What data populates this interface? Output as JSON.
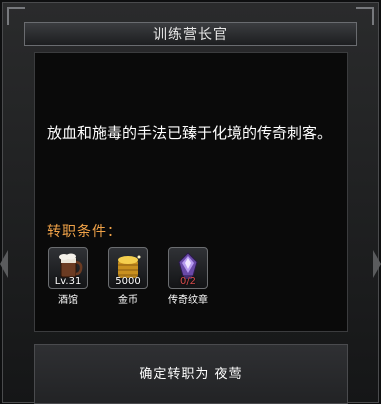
{
  "dialog": {
    "title": "训练营长官",
    "description": "放血和施毒的手法已臻于化境的传奇刺客。",
    "requirements_label": "转职条件：",
    "requirements": [
      {
        "icon": "tavern-icon",
        "badge": "Lv.31",
        "name": "酒馆"
      },
      {
        "icon": "gold-coins-icon",
        "badge": "5000",
        "name": "金币"
      },
      {
        "icon": "legendary-emblem-icon",
        "badge": "0/2",
        "name": "传奇纹章"
      }
    ],
    "confirm_label": "确定转职为 夜莺"
  },
  "colors": {
    "requirements_label": "#f0a248",
    "emblem_badge": "#d44a4a",
    "gold": "#e0b23a"
  }
}
